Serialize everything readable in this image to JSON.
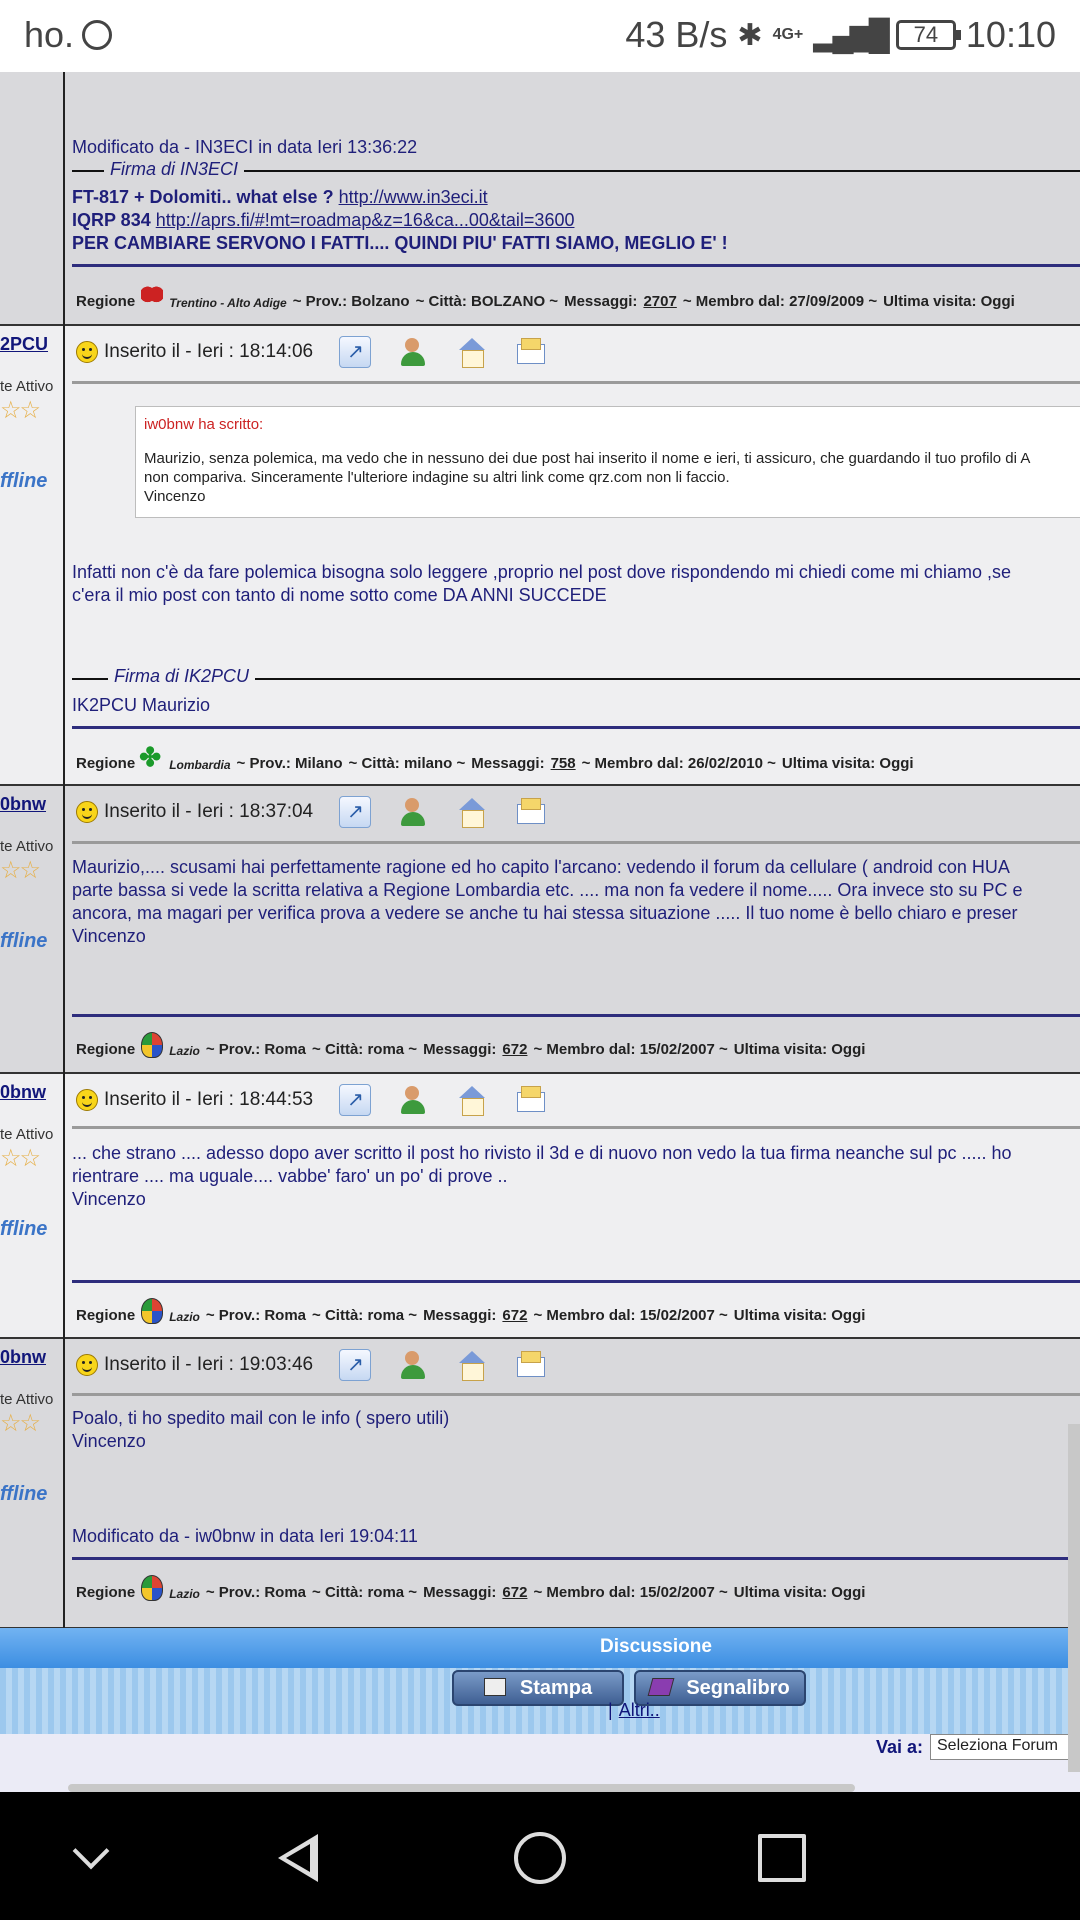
{
  "status_bar": {
    "carrier": "ho.",
    "whatsapp_icon": "whatsapp-icon",
    "speed": "43 B/s",
    "network": "4G+",
    "battery": "74",
    "time": "10:10"
  },
  "post0": {
    "modified": "Modificato da - IN3ECI in data Ieri 13:36:22",
    "signature_label": "Firma di IN3ECI",
    "sig_line1_text": "FT-817 + Dolomiti.. what else ? ",
    "sig_line1_link": "http://www.in3eci.it",
    "sig_line2_text": "IQRP 834 ",
    "sig_line2_link": "http://aprs.fi/#!mt=roadmap&z=16&ca...00&tail=3600",
    "sig_line3": "PER CAMBIARE SERVONO I FATTI.... QUINDI PIU' FATTI SIAMO, MEGLIO E' !",
    "footer": {
      "regione_label": "Regione",
      "regione": "Trentino - Alto Adige",
      "prov": "~ Prov.: Bolzano",
      "citta": "~ Città: BOLZANO ~",
      "messaggi_label": "Messaggi:",
      "messaggi": "2707",
      "membro": "~ Membro dal: 27/09/2009 ~",
      "visita": "Ultima visita: Oggi"
    }
  },
  "post1": {
    "user": "2PCU",
    "rank": "te Attivo",
    "stars": "☆☆",
    "status": "ffline",
    "inserted": "Inserito il - Ieri : 18:14:06",
    "quote_author": "iw0bnw ha scritto:",
    "quote_line1": "Maurizio, senza polemica, ma vedo che in nessuno dei due post hai inserito il nome e ieri, ti assicuro, che guardando il tuo profilo di A",
    "quote_line2": "non compariva. Sinceramente l'ulteriore indagine su altri link come qrz.com non li faccio.",
    "quote_line3": "Vincenzo",
    "body_line1": "Infatti non c'è da fare polemica bisogna solo leggere ,proprio nel post dove rispondendo mi chiedi come mi chiamo ,se",
    "body_line2": "c'era il mio post con tanto di nome sotto come DA ANNI SUCCEDE",
    "signature_label": "Firma di IK2PCU",
    "signature_text": "IK2PCU Maurizio",
    "footer": {
      "regione_label": "Regione",
      "regione": "Lombardia",
      "prov": "~ Prov.: Milano",
      "citta": "~ Città: milano ~",
      "messaggi_label": "Messaggi:",
      "messaggi": "758",
      "membro": "~ Membro dal: 26/02/2010 ~",
      "visita": "Ultima visita: Oggi"
    }
  },
  "post2": {
    "user": "0bnw",
    "rank": "te Attivo",
    "stars": "☆☆",
    "status": "ffline",
    "inserted": "Inserito il - Ieri : 18:37:04",
    "body_line1": "Maurizio,.... scusami hai perfettamente ragione ed ho capito l'arcano: vedendo il forum da cellulare ( android con HUA",
    "body_line2": "parte bassa si vede la scritta relativa a Regione Lombardia etc. .... ma non fa vedere il nome..... Ora invece sto su PC e",
    "body_line3": "ancora, ma magari per verifica prova a vedere se anche tu hai stessa situazione ..... Il tuo nome è bello chiaro e preser",
    "body_line4": "Vincenzo",
    "footer": {
      "regione_label": "Regione",
      "regione": "Lazio",
      "prov": "~ Prov.: Roma",
      "citta": "~ Città: roma ~",
      "messaggi_label": "Messaggi:",
      "messaggi": "672",
      "membro": "~ Membro dal: 15/02/2007 ~",
      "visita": "Ultima visita: Oggi"
    }
  },
  "post3": {
    "user": "0bnw",
    "rank": "te Attivo",
    "stars": "☆☆",
    "status": "ffline",
    "inserted": "Inserito il - Ieri : 18:44:53",
    "body_line1": "... che strano .... adesso dopo aver scritto il post ho rivisto il 3d e di nuovo non vedo la tua firma neanche sul pc ..... ho",
    "body_line2": "rientrare .... ma uguale.... vabbe' faro' un po' di prove ..",
    "body_line3": "Vincenzo",
    "footer": {
      "regione_label": "Regione",
      "regione": "Lazio",
      "prov": "~ Prov.: Roma",
      "citta": "~ Città: roma ~",
      "messaggi_label": "Messaggi:",
      "messaggi": "672",
      "membro": "~ Membro dal: 15/02/2007 ~",
      "visita": "Ultima visita: Oggi"
    }
  },
  "post4": {
    "user": "0bnw",
    "rank": "te Attivo",
    "stars": "☆☆",
    "status": "ffline",
    "inserted": "Inserito il - Ieri : 19:03:46",
    "body_line1": "Poalo, ti ho spedito mail con le info ( spero utili)",
    "body_line2": "Vincenzo",
    "modified": "Modificato da - iw0bnw in data Ieri 19:04:11",
    "footer": {
      "regione_label": "Regione",
      "regione": "Lazio",
      "prov": "~ Prov.: Roma",
      "citta": "~ Città: roma ~",
      "messaggi_label": "Messaggi:",
      "messaggi": "672",
      "membro": "~ Membro dal: 15/02/2007 ~",
      "visita": "Ultima visita: Oggi"
    }
  },
  "bottom": {
    "discussione": "Discussione",
    "stampa": "Stampa",
    "segnalibro": "Segnalibro",
    "altri_sep": "|",
    "altri": "Altri..",
    "vai_a": "Vai a:",
    "select_value": "Seleziona Forum"
  }
}
